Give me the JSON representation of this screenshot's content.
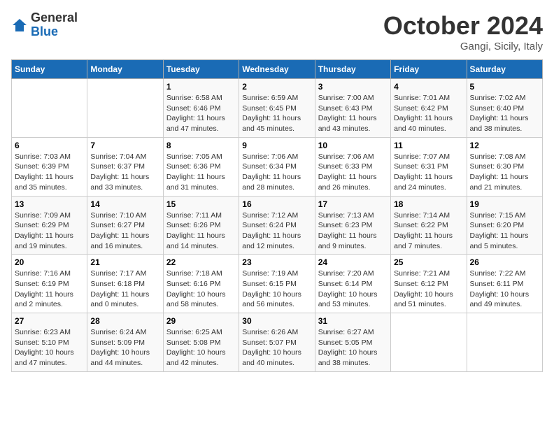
{
  "header": {
    "logo": {
      "general": "General",
      "blue": "Blue"
    },
    "title": "October 2024",
    "location": "Gangi, Sicily, Italy"
  },
  "calendar": {
    "days_of_week": [
      "Sunday",
      "Monday",
      "Tuesday",
      "Wednesday",
      "Thursday",
      "Friday",
      "Saturday"
    ],
    "weeks": [
      [
        {
          "day": null
        },
        {
          "day": null
        },
        {
          "day": "1",
          "sunrise": "Sunrise: 6:58 AM",
          "sunset": "Sunset: 6:46 PM",
          "daylight": "Daylight: 11 hours and 47 minutes."
        },
        {
          "day": "2",
          "sunrise": "Sunrise: 6:59 AM",
          "sunset": "Sunset: 6:45 PM",
          "daylight": "Daylight: 11 hours and 45 minutes."
        },
        {
          "day": "3",
          "sunrise": "Sunrise: 7:00 AM",
          "sunset": "Sunset: 6:43 PM",
          "daylight": "Daylight: 11 hours and 43 minutes."
        },
        {
          "day": "4",
          "sunrise": "Sunrise: 7:01 AM",
          "sunset": "Sunset: 6:42 PM",
          "daylight": "Daylight: 11 hours and 40 minutes."
        },
        {
          "day": "5",
          "sunrise": "Sunrise: 7:02 AM",
          "sunset": "Sunset: 6:40 PM",
          "daylight": "Daylight: 11 hours and 38 minutes."
        }
      ],
      [
        {
          "day": "6",
          "sunrise": "Sunrise: 7:03 AM",
          "sunset": "Sunset: 6:39 PM",
          "daylight": "Daylight: 11 hours and 35 minutes."
        },
        {
          "day": "7",
          "sunrise": "Sunrise: 7:04 AM",
          "sunset": "Sunset: 6:37 PM",
          "daylight": "Daylight: 11 hours and 33 minutes."
        },
        {
          "day": "8",
          "sunrise": "Sunrise: 7:05 AM",
          "sunset": "Sunset: 6:36 PM",
          "daylight": "Daylight: 11 hours and 31 minutes."
        },
        {
          "day": "9",
          "sunrise": "Sunrise: 7:06 AM",
          "sunset": "Sunset: 6:34 PM",
          "daylight": "Daylight: 11 hours and 28 minutes."
        },
        {
          "day": "10",
          "sunrise": "Sunrise: 7:06 AM",
          "sunset": "Sunset: 6:33 PM",
          "daylight": "Daylight: 11 hours and 26 minutes."
        },
        {
          "day": "11",
          "sunrise": "Sunrise: 7:07 AM",
          "sunset": "Sunset: 6:31 PM",
          "daylight": "Daylight: 11 hours and 24 minutes."
        },
        {
          "day": "12",
          "sunrise": "Sunrise: 7:08 AM",
          "sunset": "Sunset: 6:30 PM",
          "daylight": "Daylight: 11 hours and 21 minutes."
        }
      ],
      [
        {
          "day": "13",
          "sunrise": "Sunrise: 7:09 AM",
          "sunset": "Sunset: 6:29 PM",
          "daylight": "Daylight: 11 hours and 19 minutes."
        },
        {
          "day": "14",
          "sunrise": "Sunrise: 7:10 AM",
          "sunset": "Sunset: 6:27 PM",
          "daylight": "Daylight: 11 hours and 16 minutes."
        },
        {
          "day": "15",
          "sunrise": "Sunrise: 7:11 AM",
          "sunset": "Sunset: 6:26 PM",
          "daylight": "Daylight: 11 hours and 14 minutes."
        },
        {
          "day": "16",
          "sunrise": "Sunrise: 7:12 AM",
          "sunset": "Sunset: 6:24 PM",
          "daylight": "Daylight: 11 hours and 12 minutes."
        },
        {
          "day": "17",
          "sunrise": "Sunrise: 7:13 AM",
          "sunset": "Sunset: 6:23 PM",
          "daylight": "Daylight: 11 hours and 9 minutes."
        },
        {
          "day": "18",
          "sunrise": "Sunrise: 7:14 AM",
          "sunset": "Sunset: 6:22 PM",
          "daylight": "Daylight: 11 hours and 7 minutes."
        },
        {
          "day": "19",
          "sunrise": "Sunrise: 7:15 AM",
          "sunset": "Sunset: 6:20 PM",
          "daylight": "Daylight: 11 hours and 5 minutes."
        }
      ],
      [
        {
          "day": "20",
          "sunrise": "Sunrise: 7:16 AM",
          "sunset": "Sunset: 6:19 PM",
          "daylight": "Daylight: 11 hours and 2 minutes."
        },
        {
          "day": "21",
          "sunrise": "Sunrise: 7:17 AM",
          "sunset": "Sunset: 6:18 PM",
          "daylight": "Daylight: 11 hours and 0 minutes."
        },
        {
          "day": "22",
          "sunrise": "Sunrise: 7:18 AM",
          "sunset": "Sunset: 6:16 PM",
          "daylight": "Daylight: 10 hours and 58 minutes."
        },
        {
          "day": "23",
          "sunrise": "Sunrise: 7:19 AM",
          "sunset": "Sunset: 6:15 PM",
          "daylight": "Daylight: 10 hours and 56 minutes."
        },
        {
          "day": "24",
          "sunrise": "Sunrise: 7:20 AM",
          "sunset": "Sunset: 6:14 PM",
          "daylight": "Daylight: 10 hours and 53 minutes."
        },
        {
          "day": "25",
          "sunrise": "Sunrise: 7:21 AM",
          "sunset": "Sunset: 6:12 PM",
          "daylight": "Daylight: 10 hours and 51 minutes."
        },
        {
          "day": "26",
          "sunrise": "Sunrise: 7:22 AM",
          "sunset": "Sunset: 6:11 PM",
          "daylight": "Daylight: 10 hours and 49 minutes."
        }
      ],
      [
        {
          "day": "27",
          "sunrise": "Sunrise: 6:23 AM",
          "sunset": "Sunset: 5:10 PM",
          "daylight": "Daylight: 10 hours and 47 minutes."
        },
        {
          "day": "28",
          "sunrise": "Sunrise: 6:24 AM",
          "sunset": "Sunset: 5:09 PM",
          "daylight": "Daylight: 10 hours and 44 minutes."
        },
        {
          "day": "29",
          "sunrise": "Sunrise: 6:25 AM",
          "sunset": "Sunset: 5:08 PM",
          "daylight": "Daylight: 10 hours and 42 minutes."
        },
        {
          "day": "30",
          "sunrise": "Sunrise: 6:26 AM",
          "sunset": "Sunset: 5:07 PM",
          "daylight": "Daylight: 10 hours and 40 minutes."
        },
        {
          "day": "31",
          "sunrise": "Sunrise: 6:27 AM",
          "sunset": "Sunset: 5:05 PM",
          "daylight": "Daylight: 10 hours and 38 minutes."
        },
        {
          "day": null
        },
        {
          "day": null
        }
      ]
    ]
  }
}
